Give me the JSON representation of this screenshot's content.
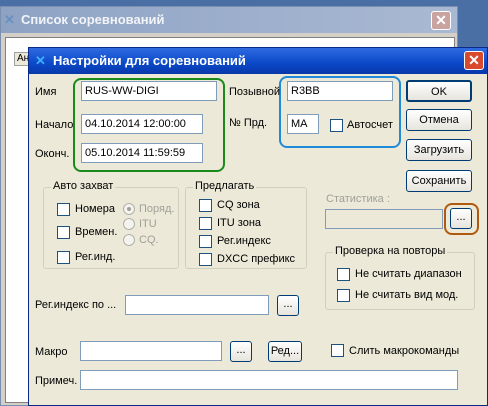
{
  "bg_window": {
    "title": "Список соревнований",
    "column_stub": "Ан",
    "close_glyph": "✕"
  },
  "dialog": {
    "title": "Настройки для соревнований",
    "close_glyph": "✕",
    "fields": {
      "name_label": "Имя",
      "name_value": "RUS-WW-DIGI",
      "start_label": "Начало",
      "start_value": "04.10.2014 12:00:00",
      "end_label": "Оконч.",
      "end_value": "05.10.2014 11:59:59",
      "callsign_label": "Позывной",
      "callsign_value": "R3BB",
      "num_label": "№ Прд.",
      "num_value": "MA",
      "autocount_label": "Автосчет"
    },
    "buttons": {
      "ok": "OK",
      "cancel": "Отмена",
      "load": "Загрузить",
      "save": "Сохранить",
      "browse": "...",
      "edit": "Ред..."
    },
    "auto_capture": {
      "title": "Авто захват",
      "numbers": "Номера",
      "time": "Времен.",
      "regind": "Рег.инд.",
      "order": "Поряд.",
      "itu": "ITU",
      "cq": "CQ."
    },
    "offer": {
      "title": "Предлагать",
      "items": [
        "CQ зона",
        "ITU зона",
        "Рег.индекс",
        "DXCC префикс"
      ]
    },
    "statistics_label": "Статистика :",
    "repeat_check": {
      "title": "Проверка на повторы",
      "items": [
        "Не считать диапазон",
        "Не считать вид мод."
      ]
    },
    "regindex_label": "Рег.индекс по ...",
    "macro_label": "Макро",
    "merge_macro_label": "Слить макрокоманды",
    "note_label": "Примеч."
  },
  "colors": {
    "highlight_green": "#1a8a1a",
    "highlight_blue": "#1f8ad8",
    "highlight_brown": "#b05a10",
    "xp_title_blue": "#0a48c8"
  },
  "icons": {
    "app": "butterfly-icon",
    "close": "close-icon"
  }
}
